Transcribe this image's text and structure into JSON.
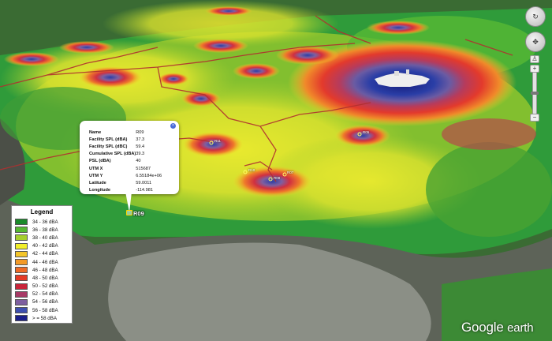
{
  "balloon": {
    "rows": [
      {
        "key": "Name",
        "value": "R09"
      },
      {
        "key": "Facility SPL (dBA)",
        "value": "37.3"
      },
      {
        "key": "Facility SPL (dBC)",
        "value": "59.4"
      },
      {
        "key": "Cumulative SPL (dBA)",
        "value": "39.3"
      },
      {
        "key": "PSL (dBA)",
        "value": "40"
      },
      {
        "key": "UTM X",
        "value": "515687"
      },
      {
        "key": "UTM Y",
        "value": "6.55184e+06"
      },
      {
        "key": "Latitude",
        "value": "59.0011"
      },
      {
        "key": "Longitude",
        "value": "-114.981"
      }
    ],
    "close_glyph": "×"
  },
  "marker": {
    "label": "R09"
  },
  "small_labels": [
    "R11",
    "R10",
    "R08",
    "R07",
    "R05"
  ],
  "legend": {
    "title": "Legend",
    "items": [
      {
        "label": "34 - 36 dBA",
        "color": "#1a8a2a"
      },
      {
        "label": "36 - 38 dBA",
        "color": "#55b832"
      },
      {
        "label": "38 - 40 dBA",
        "color": "#a6cf2e"
      },
      {
        "label": "40 - 42 dBA",
        "color": "#f2ef2a"
      },
      {
        "label": "42 - 44 dBA",
        "color": "#f4c52a"
      },
      {
        "label": "44 - 46 dBA",
        "color": "#f39a28"
      },
      {
        "label": "46 - 48 dBA",
        "color": "#ee6a26"
      },
      {
        "label": "48 - 50 dBA",
        "color": "#e53a26"
      },
      {
        "label": "50 - 52 dBA",
        "color": "#c9243a"
      },
      {
        "label": "52 - 54 dBA",
        "color": "#a83a66"
      },
      {
        "label": "54 - 56 dBA",
        "color": "#7e5fa0"
      },
      {
        "label": "56 - 58 dBA",
        "color": "#3e4fb0"
      },
      {
        "label": "> = 58 dBA",
        "color": "#1b1f8a"
      }
    ]
  },
  "nav": {
    "look_glyph": "↻",
    "move_glyph": "✥",
    "zoom_in": "+",
    "zoom_out": "−",
    "person_glyph": "♙"
  },
  "brand": {
    "word1": "Google",
    "word2": "earth"
  }
}
